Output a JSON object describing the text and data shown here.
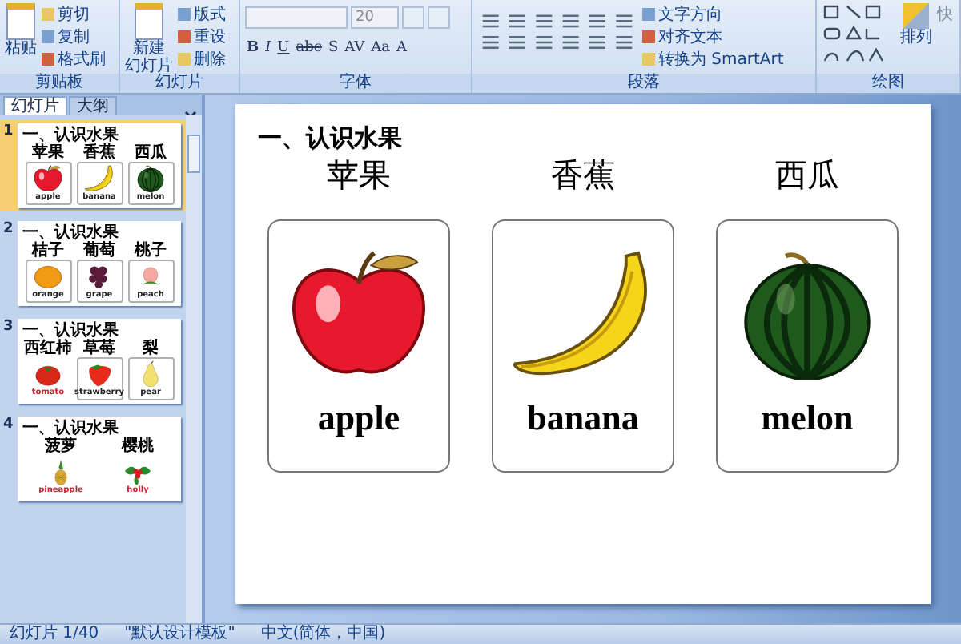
{
  "ribbon": {
    "groups": [
      {
        "kind": "clipboard",
        "label": "剪贴板",
        "big": [
          "粘贴"
        ],
        "items": [
          "剪切",
          "复制",
          "格式刷"
        ]
      },
      {
        "kind": "slides",
        "label": "幻灯片",
        "big": [
          "新建",
          "幻灯片"
        ],
        "items": [
          "版式",
          "重设",
          "删除"
        ]
      },
      {
        "kind": "font",
        "label": "字体",
        "font_size": "20",
        "buttons": [
          "B",
          "I",
          "U",
          "abc",
          "S",
          "AV",
          "Aa",
          "A"
        ]
      },
      {
        "kind": "paragraph",
        "label": "段落",
        "items": [
          "文字方向",
          "对齐文本",
          "转换为 SmartArt"
        ]
      },
      {
        "kind": "drawing",
        "label": "绘图",
        "big": [
          "排列"
        ],
        "extra": "快"
      }
    ]
  },
  "pane": {
    "tabs": [
      {
        "label": "幻灯片",
        "selected": true
      },
      {
        "label": "大纲",
        "selected": false
      }
    ],
    "slides": [
      {
        "number": "1",
        "selected": true,
        "heading": "一、认识水果",
        "fruits": [
          {
            "cn": "苹果",
            "en": "apple",
            "kind": "apple",
            "card": true,
            "color": "#222222"
          },
          {
            "cn": "香蕉",
            "en": "banana",
            "kind": "banana",
            "card": true,
            "color": "#222222"
          },
          {
            "cn": "西瓜",
            "en": "melon",
            "kind": "melon",
            "card": true,
            "color": "#222222"
          }
        ]
      },
      {
        "number": "2",
        "selected": false,
        "heading": "一、认识水果",
        "fruits": [
          {
            "cn": "桔子",
            "en": "orange",
            "kind": "orange",
            "card": true,
            "color": "#222222"
          },
          {
            "cn": "葡萄",
            "en": "grape",
            "kind": "grape",
            "card": true,
            "color": "#222222"
          },
          {
            "cn": "桃子",
            "en": "peach",
            "kind": "peach",
            "card": true,
            "color": "#222222"
          }
        ]
      },
      {
        "number": "3",
        "selected": false,
        "heading": "一、认识水果",
        "fruits": [
          {
            "cn": "西红柿",
            "en": "tomato",
            "kind": "tomato",
            "card": false,
            "color": "#cc1f2f"
          },
          {
            "cn": "草莓",
            "en": "strawberry",
            "kind": "strawberry",
            "card": true,
            "color": "#222222"
          },
          {
            "cn": "梨",
            "en": "pear",
            "kind": "pear",
            "card": true,
            "color": "#222222"
          }
        ]
      },
      {
        "number": "4",
        "selected": false,
        "heading": "一、认识水果",
        "fruits": [
          {
            "cn": "菠萝",
            "en": "pineapple",
            "kind": "pineapple",
            "card": false,
            "color": "#cc1f2f"
          },
          {
            "cn": "樱桃",
            "en": "holly",
            "kind": "holly",
            "card": false,
            "color": "#cc1f2f"
          }
        ]
      }
    ]
  },
  "slide": {
    "heading": "一、认识水果",
    "fruits": [
      {
        "cn": "苹果",
        "en": "apple",
        "kind": "apple"
      },
      {
        "cn": "香蕉",
        "en": "banana",
        "kind": "banana"
      },
      {
        "cn": "西瓜",
        "en": "melon",
        "kind": "melon"
      }
    ]
  },
  "status_bar": [
    "幻灯片 1/40",
    "\"默认设计模板\"",
    "中文(简体，中国)"
  ]
}
